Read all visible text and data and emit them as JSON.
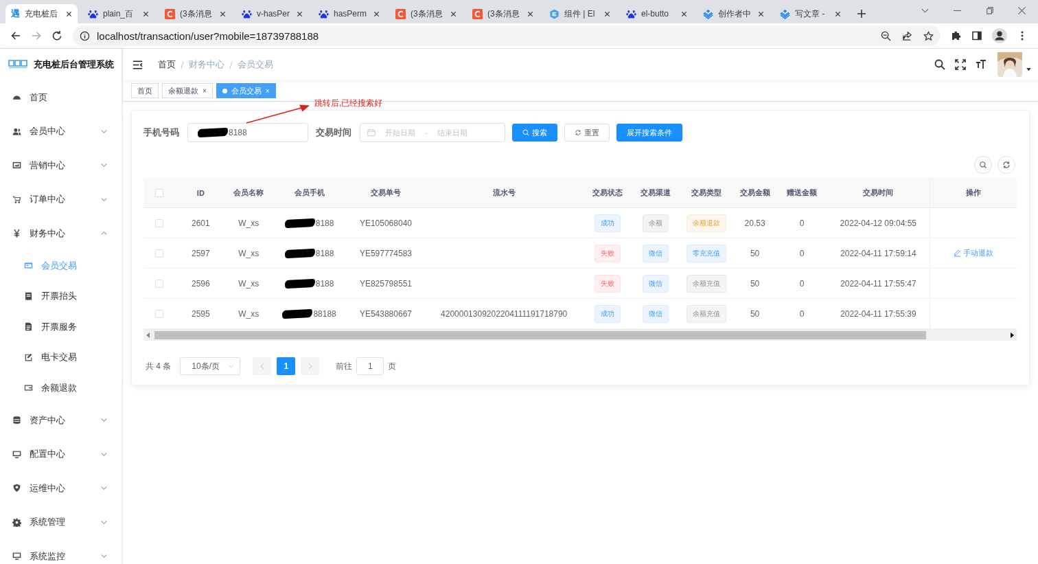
{
  "browser": {
    "tabs": [
      {
        "kind": "yu",
        "favicon_text": "遇",
        "title": "充电桩后",
        "selected": true
      },
      {
        "kind": "baidu",
        "title": "plain_百",
        "selected": false
      },
      {
        "kind": "csdn",
        "title": "(3条消息",
        "selected": false
      },
      {
        "kind": "baidu",
        "title": "v-hasPer",
        "selected": false
      },
      {
        "kind": "baidu",
        "title": "hasPerm",
        "selected": false
      },
      {
        "kind": "csdn",
        "title": "(3条消息",
        "selected": false
      },
      {
        "kind": "csdn",
        "title": "(3条消息",
        "selected": false
      },
      {
        "kind": "element",
        "title": "组件 | El",
        "selected": false
      },
      {
        "kind": "baidu",
        "title": "el-butto",
        "selected": false
      },
      {
        "kind": "juejin",
        "title": "创作者中",
        "selected": false
      },
      {
        "kind": "juejin",
        "title": "写文章 -",
        "selected": false
      }
    ],
    "address": "localhost/transaction/user?mobile=18739788188"
  },
  "app": {
    "title": "充电桩后台管理系统",
    "menu": [
      {
        "label": "首页",
        "kind": "link"
      },
      {
        "label": "会员中心",
        "kind": "group",
        "expanded": false
      },
      {
        "label": "营销中心",
        "kind": "group",
        "expanded": false
      },
      {
        "label": "订单中心",
        "kind": "group",
        "expanded": false
      },
      {
        "label": "财务中心",
        "kind": "group",
        "expanded": true,
        "children": [
          {
            "label": "会员交易",
            "selected": true
          },
          {
            "label": "开票抬头",
            "selected": false
          },
          {
            "label": "开票服务",
            "selected": false
          },
          {
            "label": "电卡交易",
            "selected": false
          },
          {
            "label": "余额退款",
            "selected": false
          }
        ]
      },
      {
        "label": "资产中心",
        "kind": "group",
        "expanded": false
      },
      {
        "label": "配置中心",
        "kind": "group",
        "expanded": false
      },
      {
        "label": "运维中心",
        "kind": "group",
        "expanded": false
      },
      {
        "label": "系统管理",
        "kind": "group",
        "expanded": false
      },
      {
        "label": "系统监控",
        "kind": "group",
        "expanded": false
      }
    ],
    "breadcrumb": [
      "首页",
      "财务中心",
      "会员交易"
    ],
    "tags": [
      {
        "label": "首页",
        "selected": false
      },
      {
        "label": "余额退款",
        "selected": false,
        "close": "×"
      },
      {
        "label": "会员交易",
        "selected": true,
        "close": "×"
      }
    ]
  },
  "annotation": {
    "text": "跳转后,已经搜索好"
  },
  "search": {
    "phone": {
      "label": "手机号码",
      "value": "8188",
      "redacted": true
    },
    "date": {
      "label": "交易时间",
      "start_placeholder": "开始日期",
      "separator": "-",
      "end_placeholder": "结束日期"
    },
    "buttons": [
      {
        "label": "搜索",
        "kind": "primary-search"
      },
      {
        "label": "重置",
        "kind": "reset"
      },
      {
        "label": "展开搜索条件",
        "kind": "primary"
      }
    ]
  },
  "table": {
    "header_checked": false,
    "columns": [
      "ID",
      "会员名称",
      "会员手机",
      "交易单号",
      "流水号",
      "交易状态",
      "交易渠道",
      "交易类型",
      "交易金额",
      "赠送金额",
      "交易时间",
      "操作"
    ],
    "rows": [
      {
        "checked": false,
        "id": "2601",
        "name": "W_xs",
        "phone": "8188",
        "redacted": true,
        "order_no": "YE105068040",
        "status": {
          "text": "成功",
          "kind": "primary"
        },
        "channel": {
          "text": "余额",
          "kind": "info"
        },
        "type": {
          "text": "余额退款",
          "kind": "warning"
        },
        "amount": "20.53",
        "gift": "0",
        "time": "2022-04-12 09:04:55"
      },
      {
        "checked": false,
        "id": "2597",
        "name": "W_xs",
        "phone": "8188",
        "redacted": true,
        "order_no": "YE597774583",
        "status": {
          "text": "失败",
          "kind": "danger"
        },
        "channel": {
          "text": "微信",
          "kind": "primary"
        },
        "type": {
          "text": "零充充值",
          "kind": "primary"
        },
        "amount": "50",
        "gift": "0",
        "time": "2022-04-11 17:59:14",
        "action": "手动退款"
      },
      {
        "checked": false,
        "id": "2596",
        "name": "W_xs",
        "phone": "8188",
        "redacted": true,
        "order_no": "YE825798551",
        "status": {
          "text": "失败",
          "kind": "danger"
        },
        "channel": {
          "text": "微信",
          "kind": "primary"
        },
        "type": {
          "text": "余额充值",
          "kind": "info"
        },
        "amount": "50",
        "gift": "0",
        "time": "2022-04-11 17:55:47"
      },
      {
        "checked": false,
        "id": "2595",
        "name": "W_xs",
        "phone": "88188",
        "redacted": true,
        "order_no": "YE543880667",
        "serial": "4200001309202204111191718790",
        "status": {
          "text": "成功",
          "kind": "primary"
        },
        "channel": {
          "text": "微信",
          "kind": "primary"
        },
        "type": {
          "text": "余额充值",
          "kind": "info"
        },
        "amount": "50",
        "gift": "0",
        "time": "2022-04-11 17:55:39"
      }
    ]
  },
  "pagination": {
    "total": "共 4 条",
    "page_size": "10条/页",
    "pages": [
      {
        "label": "1",
        "selected": true
      }
    ],
    "goto_label": "前往",
    "goto_value": "1",
    "page_unit": "页"
  }
}
